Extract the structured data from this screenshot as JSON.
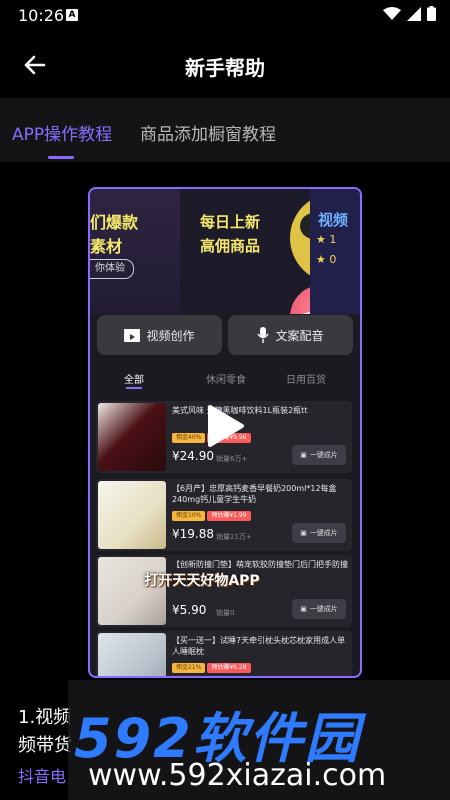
{
  "status_bar": {
    "time": "10:26",
    "notif_badge": "A"
  },
  "header": {
    "title": "新手帮助"
  },
  "tabs": [
    {
      "label": "APP操作教程",
      "active": true
    },
    {
      "label": "商品添加橱窗教程",
      "active": false
    }
  ],
  "video": {
    "banner": {
      "left_line1": "们爆款",
      "left_line2": "素材",
      "pill": "你体验",
      "daily": "每日上新",
      "commission": "高佣商品",
      "side_title": "视频",
      "side_item1": "★ 1",
      "side_item2": "★ 0"
    },
    "actions": {
      "video_create": "视频创作",
      "voice_over": "文案配音"
    },
    "categories": [
      "全部",
      "休闲零食",
      "日用百货"
    ],
    "products": [
      {
        "title": "美式风味 无糖黑咖啡饮料1L瓶装2瓶tt",
        "tag1": "佣金40%",
        "tag2": "预估赚¥9.96",
        "price": "¥24.90",
        "sales": "销量6万+",
        "button": "一键成片"
      },
      {
        "title": "【6月产】忠厚高钙麦香早餐奶200ml*12每盒240mg钙儿童学生牛奶",
        "tag1": "佣金10%",
        "tag2": "预估赚¥1.99",
        "price": "¥19.88",
        "sales": "销量21万+",
        "button": "一键成片"
      },
      {
        "title": "【创新防撞门垫】萌宠软胶防撞垫门后门把手防撞",
        "tag1": "佣金",
        "tag2": "预估赚",
        "price": "¥5.90",
        "sales": "销量0",
        "button": "一键成片"
      },
      {
        "title": "【买一送一】试睡7天牵引枕头枕芯枕家用成人单人睡眠枕",
        "tag1": "佣金21%",
        "tag2": "预估赚¥6.28",
        "price": "",
        "sales": "",
        "button": ""
      }
    ],
    "overlay_text": "打开天天好物APP"
  },
  "description": {
    "line1": "1.视频",
    "line2": "频带货",
    "link": "抖音电"
  },
  "watermark": {
    "title": "592软件园",
    "url": "www.592xiazai.com"
  },
  "colors": {
    "accent": "#8a6bff",
    "background": "#000000",
    "watermark_blue": "#2f7bff"
  }
}
